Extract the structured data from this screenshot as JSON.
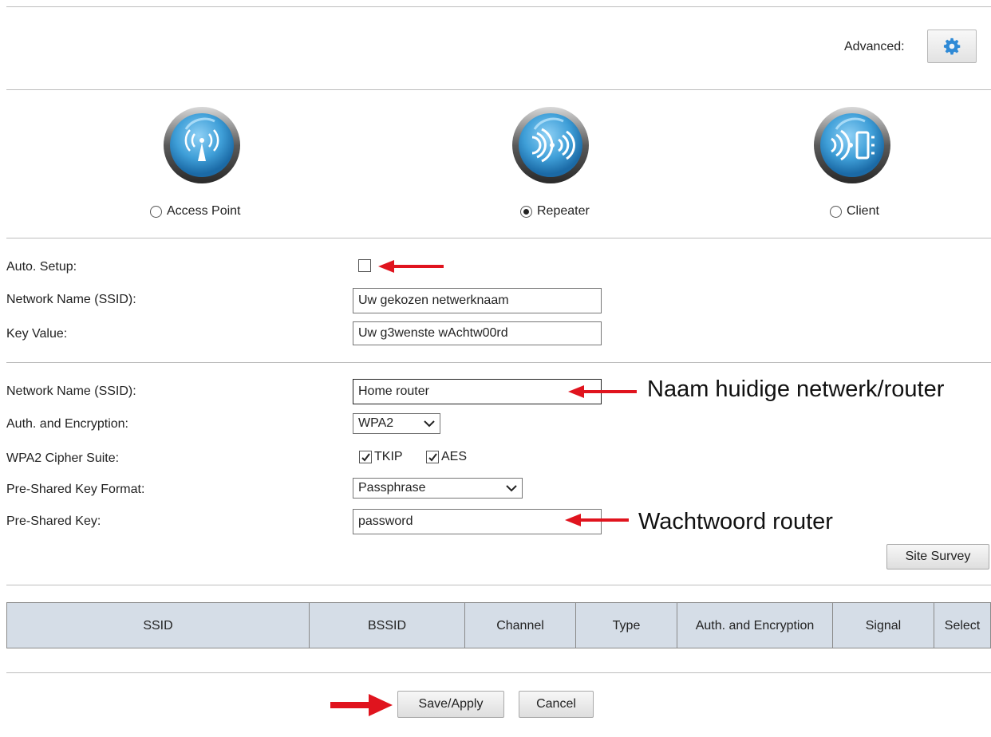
{
  "advanced": {
    "label": "Advanced:",
    "icon": "gear-icon",
    "icon_color": "#2f8ad6"
  },
  "modes": [
    {
      "label": "Access Point",
      "icon": "broadcast-tower-icon",
      "selected": false
    },
    {
      "label": "Repeater",
      "icon": "repeater-waves-icon",
      "selected": true
    },
    {
      "label": "Client",
      "icon": "client-device-icon",
      "selected": false
    }
  ],
  "local_network": {
    "auto_setup_label": "Auto. Setup:",
    "auto_setup_checked": false,
    "ssid_label": "Network Name (SSID):",
    "ssid_value": "Uw gekozen netwerknaam",
    "key_label": "Key Value:",
    "key_value": "Uw g3wenste wAchtw00rd"
  },
  "remote_network": {
    "ssid_label": "Network Name (SSID):",
    "ssid_value": "Home router",
    "auth_label": "Auth. and Encryption:",
    "auth_value": "WPA2",
    "cipher_label": "WPA2 Cipher Suite:",
    "cipher_tkip": "TKIP",
    "cipher_aes": "AES",
    "tkip_checked": true,
    "aes_checked": true,
    "psk_format_label": "Pre-Shared Key Format:",
    "psk_format_value": "Passphrase",
    "psk_label": "Pre-Shared Key:",
    "psk_value": "password"
  },
  "annotations": {
    "router_name": "Naam huidige netwerk/router",
    "router_password": "Wachtwoord  router",
    "arrow_color": "#e0141e"
  },
  "site_survey_label": "Site Survey",
  "table": {
    "headers": [
      "SSID",
      "BSSID",
      "Channel",
      "Type",
      "Auth. and Encryption",
      "Signal",
      "Select"
    ]
  },
  "footer": {
    "save_label": "Save/Apply",
    "cancel_label": "Cancel"
  },
  "colors": {
    "icon_blue": "#3f9fd8",
    "table_header_bg": "#d5dde7"
  }
}
